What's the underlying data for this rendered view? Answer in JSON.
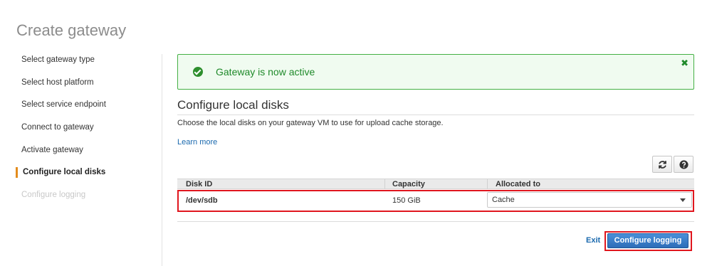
{
  "page": {
    "title": "Create gateway"
  },
  "steps": [
    {
      "label": "Select gateway type",
      "state": "done"
    },
    {
      "label": "Select host platform",
      "state": "done"
    },
    {
      "label": "Select service endpoint",
      "state": "done"
    },
    {
      "label": "Connect to gateway",
      "state": "done"
    },
    {
      "label": "Activate gateway",
      "state": "done"
    },
    {
      "label": "Configure local disks",
      "state": "active"
    },
    {
      "label": "Configure logging",
      "state": "disabled"
    }
  ],
  "alert": {
    "message": "Gateway is now active",
    "close_glyph": "✖",
    "color": "#1f8a2a"
  },
  "section": {
    "title": "Configure local disks",
    "description": "Choose the local disks on your gateway VM to use for upload cache storage.",
    "learn_more": "Learn more"
  },
  "toolbar": {
    "refresh_icon": "refresh-icon",
    "help_icon": "help-icon"
  },
  "table": {
    "headers": [
      "Disk ID",
      "Capacity",
      "Allocated to"
    ],
    "rows": [
      {
        "disk_id": "/dev/sdb",
        "capacity": "150 GiB",
        "allocated_to": "Cache"
      }
    ]
  },
  "footer": {
    "exit_label": "Exit",
    "primary_label": "Configure logging"
  },
  "colors": {
    "accent": "#e38c1d",
    "primary": "#2d6db8",
    "highlight": "#e0161e",
    "link": "#1a69ae"
  }
}
